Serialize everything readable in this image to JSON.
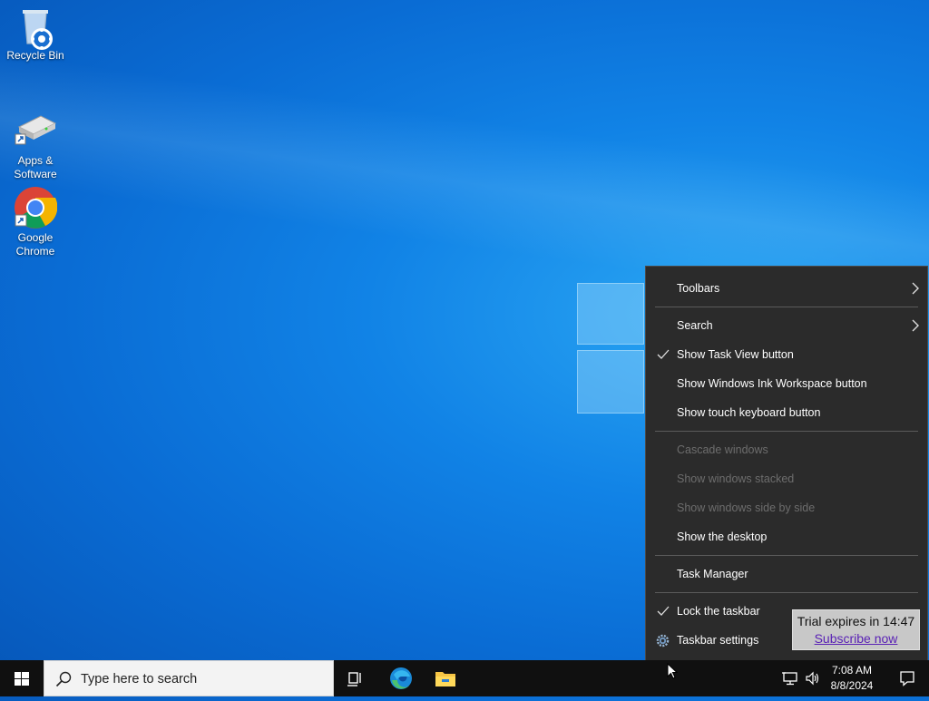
{
  "desktop": {
    "icons": [
      {
        "label": "Recycle Bin"
      },
      {
        "label": "Apps & Software"
      },
      {
        "label": "Google Chrome"
      }
    ]
  },
  "context_menu": {
    "items": [
      {
        "label": "Toolbars",
        "submenu": true,
        "enabled": true
      },
      {
        "label": "Search",
        "submenu": true,
        "enabled": true
      },
      {
        "label": "Show Task View button",
        "checked": true,
        "enabled": true
      },
      {
        "label": "Show Windows Ink Workspace button",
        "enabled": true
      },
      {
        "label": "Show touch keyboard button",
        "enabled": true
      },
      {
        "label": "Cascade windows",
        "enabled": false
      },
      {
        "label": "Show windows stacked",
        "enabled": false
      },
      {
        "label": "Show windows side by side",
        "enabled": false
      },
      {
        "label": "Show the desktop",
        "enabled": true
      },
      {
        "label": "Task Manager",
        "enabled": true
      },
      {
        "label": "Lock the taskbar",
        "checked": true,
        "enabled": true
      },
      {
        "label": "Taskbar settings",
        "icon": "gear-icon",
        "enabled": true
      }
    ]
  },
  "trial_popup": {
    "message": "Trial expires in 14:47",
    "link": "Subscribe now"
  },
  "taskbar": {
    "search_placeholder": "Type here to search",
    "pinned": [
      "task-view-icon",
      "edge-icon",
      "file-explorer-icon"
    ],
    "tray": {
      "time": "7:08 AM",
      "date": "8/8/2024"
    }
  },
  "colors": {
    "menu_bg": "#2b2b2b",
    "taskbar_bg": "#101010",
    "desktop_accent": "#0a6cd4",
    "link": "#5a22b5"
  }
}
